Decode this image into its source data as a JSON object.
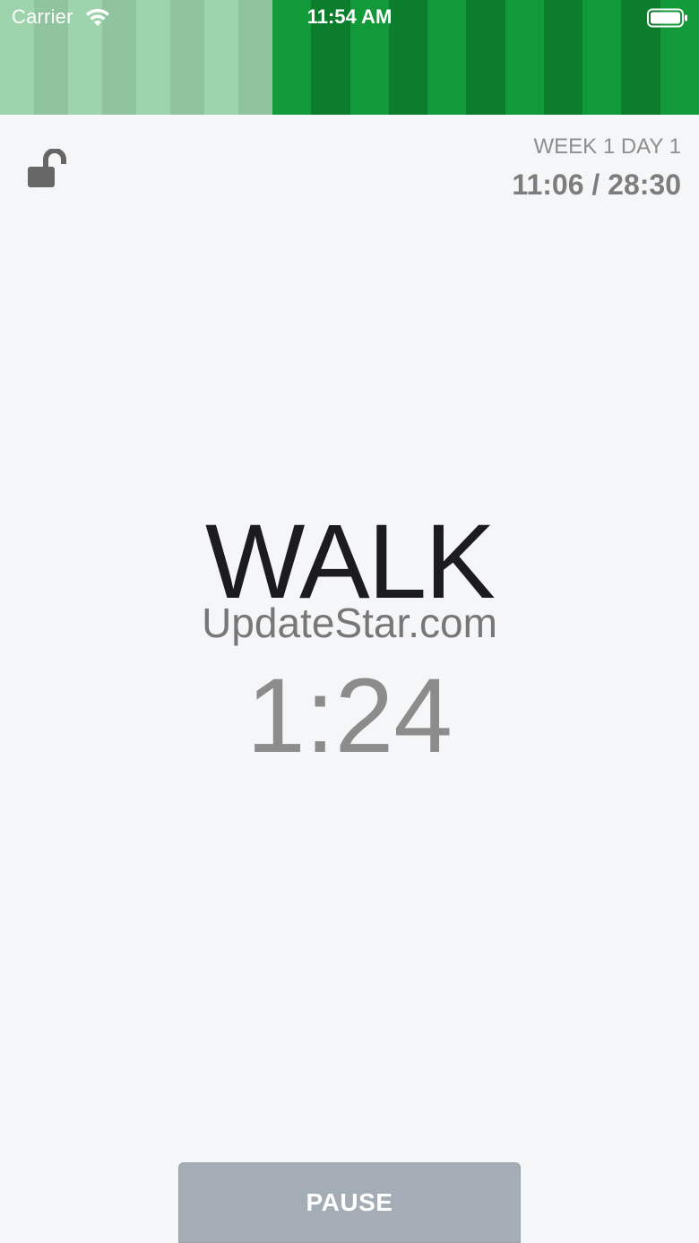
{
  "status_bar": {
    "carrier": "Carrier",
    "time": "11:54 AM"
  },
  "progress": {
    "fraction_complete": 0.39,
    "segments": [
      {
        "kind": "light-a"
      },
      {
        "kind": "light-b"
      },
      {
        "kind": "light-a"
      },
      {
        "kind": "light-b"
      },
      {
        "kind": "light-a"
      },
      {
        "kind": "light-b"
      },
      {
        "kind": "light-a"
      },
      {
        "kind": "light-b"
      },
      {
        "kind": "dark-a"
      },
      {
        "kind": "dark-b"
      },
      {
        "kind": "dark-a"
      },
      {
        "kind": "dark-b"
      },
      {
        "kind": "dark-a"
      },
      {
        "kind": "dark-b"
      },
      {
        "kind": "dark-a"
      },
      {
        "kind": "dark-b"
      },
      {
        "kind": "dark-a"
      },
      {
        "kind": "dark-b"
      },
      {
        "kind": "dark-a"
      }
    ]
  },
  "header": {
    "lock_icon": "unlocked-padlock-icon",
    "week_day": "WEEK 1 DAY 1",
    "elapsed_total": "11:06 / 28:30"
  },
  "main": {
    "activity": "WALK",
    "watermark": "UpdateStar.com",
    "countdown": "1:24"
  },
  "controls": {
    "pause_label": "PAUSE"
  },
  "colors": {
    "background": "#f4f6f8",
    "completed_light": "#9dd4ab",
    "completed_stripe": "#8fc49f",
    "remaining_green": "#12993a",
    "remaining_stripe": "#0b7d2c",
    "pause_button": "#a4adb5"
  }
}
